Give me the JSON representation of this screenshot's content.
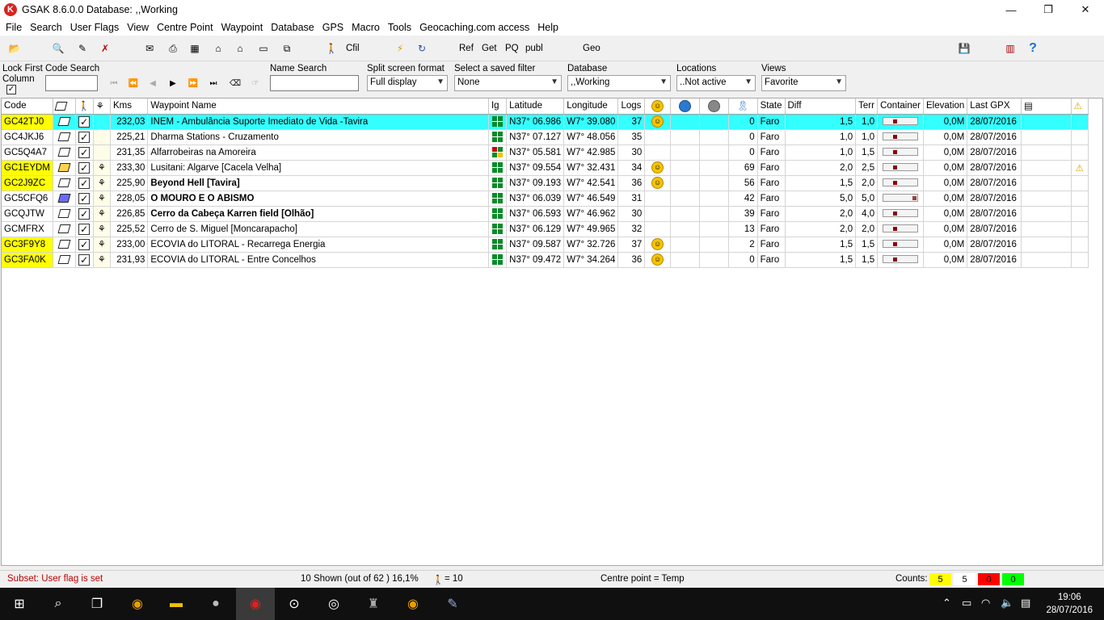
{
  "window": {
    "title": "GSAK 8.6.0.0    Database: ,,Working",
    "app_icon": "gsak-logo-icon",
    "minimize": "—",
    "restore": "❐",
    "close": "✕"
  },
  "menu": [
    "File",
    "Search",
    "User Flags",
    "View",
    "Centre Point",
    "Waypoint",
    "Database",
    "GPS",
    "Macro",
    "Tools",
    "Geocaching.com access",
    "Help"
  ],
  "toolbar": {
    "cfil": "Cfil",
    "ref": "Ref",
    "get": "Get",
    "pq": "PQ",
    "publ": "publ",
    "geo": "Geo"
  },
  "filters": {
    "lock_first": "Lock First",
    "column": "Column",
    "code_search": "Code Search",
    "name_search": "Name Search",
    "split_label": "Split screen format",
    "split_value": "Full display",
    "saved_filter_label": "Select a saved filter",
    "saved_filter_value": "None",
    "database_label": "Database",
    "database_value": ",,Working",
    "locations_label": "Locations",
    "locations_value": "..Not active",
    "views_label": "Views",
    "views_value": "Favorite"
  },
  "grid": {
    "headers": {
      "code": "Code",
      "kms": "Kms",
      "name": "Waypoint Name",
      "ig": "Ig",
      "latitude": "Latitude",
      "longitude": "Longitude",
      "logs": "Logs",
      "state": "State",
      "diff": "Diff",
      "terr": "Terr",
      "container": "Container",
      "elevation": "Elevation",
      "last_gpx": "Last GPX"
    },
    "rows": [
      {
        "code": "GC42TJ0",
        "yellow": true,
        "travel": false,
        "kms": "232,03",
        "name": "INEM - Ambulância Suporte Imediato de Vida -Tavira",
        "bold": false,
        "ig": "green",
        "lat": "N37° 06.986",
        "lon": "W7° 39.080",
        "logs": "37",
        "smiley": true,
        "count": "0",
        "state": "Faro",
        "diff": "1,5",
        "terr": "1,0",
        "cont": 1,
        "elev": "0,0M",
        "gpx": "28/07/2016",
        "warn": false,
        "selected": true
      },
      {
        "code": "GC4JKJ6",
        "yellow": false,
        "travel": false,
        "kms": "225,21",
        "name": "Dharma Stations - Cruzamento",
        "bold": false,
        "ig": "green",
        "lat": "N37° 07.127",
        "lon": "W7° 48.056",
        "logs": "35",
        "smiley": false,
        "count": "0",
        "state": "Faro",
        "diff": "1,0",
        "terr": "1,0",
        "cont": 1,
        "elev": "0,0M",
        "gpx": "28/07/2016",
        "warn": false,
        "selected": false
      },
      {
        "code": "GC5Q4A7",
        "yellow": false,
        "travel": false,
        "kms": "231,35",
        "name": "Alfarrobeiras na Amoreira",
        "bold": false,
        "ig": "mixed",
        "lat": "N37° 05.581",
        "lon": "W7° 42.985",
        "logs": "30",
        "smiley": false,
        "count": "0",
        "state": "Faro",
        "diff": "1,0",
        "terr": "1,5",
        "cont": 1,
        "elev": "0,0M",
        "gpx": "28/07/2016",
        "warn": false,
        "selected": false
      },
      {
        "code": "GC1EYDM",
        "yellow": true,
        "travel": true,
        "kms": "233,30",
        "name": "Lusitani: Algarve [Cacela Velha]",
        "bold": false,
        "ig": "green",
        "lat": "N37° 09.554",
        "lon": "W7° 32.431",
        "logs": "34",
        "smiley": true,
        "count": "69",
        "state": "Faro",
        "diff": "2,0",
        "terr": "2,5",
        "cont": 2,
        "elev": "0,0M",
        "gpx": "28/07/2016",
        "warn": true,
        "selected": false
      },
      {
        "code": "GC2J9ZC",
        "yellow": true,
        "travel": true,
        "kms": "225,90",
        "name": "Beyond Hell [Tavira]",
        "bold": true,
        "ig": "green",
        "lat": "N37° 09.193",
        "lon": "W7° 42.541",
        "logs": "36",
        "smiley": true,
        "count": "56",
        "state": "Faro",
        "diff": "1,5",
        "terr": "2,0",
        "cont": 1,
        "elev": "0,0M",
        "gpx": "28/07/2016",
        "warn": false,
        "selected": false
      },
      {
        "code": "GC5CFQ6",
        "yellow": false,
        "travel": true,
        "kms": "228,05",
        "name": "O MOURO E O ABISMO",
        "bold": true,
        "ig": "green",
        "lat": "N37° 06.039",
        "lon": "W7° 46.549",
        "logs": "31",
        "smiley": false,
        "count": "42",
        "state": "Faro",
        "diff": "5,0",
        "terr": "5,0",
        "cont": 4,
        "elev": "0,0M",
        "gpx": "28/07/2016",
        "warn": false,
        "selected": false
      },
      {
        "code": "GCQJTW",
        "yellow": false,
        "travel": true,
        "kms": "226,85",
        "name": "Cerro da Cabeça Karren field [Olhão]",
        "bold": true,
        "ig": "green",
        "lat": "N37° 06.593",
        "lon": "W7° 46.962",
        "logs": "30",
        "smiley": false,
        "count": "39",
        "state": "Faro",
        "diff": "2,0",
        "terr": "4,0",
        "cont": 2,
        "elev": "0,0M",
        "gpx": "28/07/2016",
        "warn": false,
        "selected": false
      },
      {
        "code": "GCMFRX",
        "yellow": false,
        "travel": true,
        "kms": "225,52",
        "name": "Cerro de S. Miguel [Moncarapacho]",
        "bold": false,
        "ig": "green",
        "lat": "N37° 06.129",
        "lon": "W7° 49.965",
        "logs": "32",
        "smiley": false,
        "count": "13",
        "state": "Faro",
        "diff": "2,0",
        "terr": "2,0",
        "cont": 2,
        "elev": "0,0M",
        "gpx": "28/07/2016",
        "warn": false,
        "selected": false
      },
      {
        "code": "GC3F9Y8",
        "yellow": true,
        "travel": true,
        "kms": "233,00",
        "name": "ECOVIA do LITORAL - Recarrega Energia",
        "bold": false,
        "ig": "green",
        "lat": "N37° 09.587",
        "lon": "W7° 32.726",
        "logs": "37",
        "smiley": true,
        "count": "2",
        "state": "Faro",
        "diff": "1,5",
        "terr": "1,5",
        "cont": 1,
        "elev": "0,0M",
        "gpx": "28/07/2016",
        "warn": false,
        "selected": false
      },
      {
        "code": "GC3FA0K",
        "yellow": true,
        "travel": true,
        "kms": "231,93",
        "name": "ECOVIA do LITORAL - Entre Concelhos",
        "bold": false,
        "ig": "green",
        "lat": "N37° 09.472",
        "lon": "W7° 34.264",
        "logs": "36",
        "smiley": true,
        "count": "0",
        "state": "Faro",
        "diff": "1,5",
        "terr": "1,5",
        "cont": 1,
        "elev": "0,0M",
        "gpx": "28/07/2016",
        "warn": false,
        "selected": false
      }
    ]
  },
  "status": {
    "subset": "Subset: User flag is set",
    "shown": "10 Shown (out of 62 )  16,1%",
    "flagged": "= 10",
    "centre": "Centre point = Temp",
    "counts_label": "Counts:",
    "counts": [
      {
        "value": "5",
        "color": "#ffff00"
      },
      {
        "value": "5",
        "color": "#ffffff"
      },
      {
        "value": "0",
        "color": "#ff0000"
      },
      {
        "value": "0",
        "color": "#00ff00"
      }
    ]
  },
  "taskbar": {
    "time": "19:06",
    "date": "28/07/2016"
  }
}
